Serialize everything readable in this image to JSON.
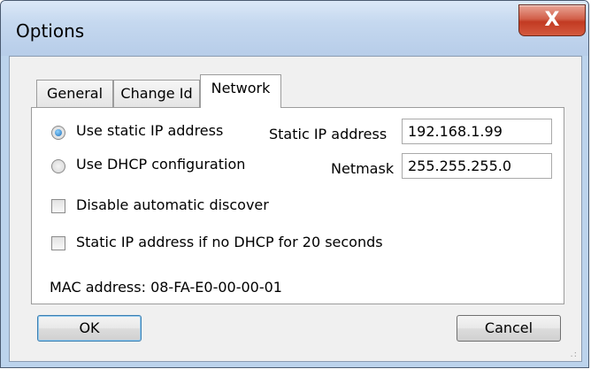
{
  "window": {
    "title": "Options",
    "close_glyph": "X"
  },
  "tabs": [
    {
      "label": "General"
    },
    {
      "label": "Change Id"
    },
    {
      "label": "Network"
    }
  ],
  "network": {
    "static_radio_label": "Use static IP address",
    "dhcp_radio_label": "Use DHCP configuration",
    "selected_mode": "static",
    "static_ip_label": "Static IP address",
    "static_ip_value": "192.168.1.99",
    "netmask_label": "Netmask",
    "netmask_value": "255.255.255.0",
    "disable_discover_label": "Disable automatic discover",
    "disable_discover_checked": false,
    "static_fallback_label": "Static IP address if no DHCP for 20 seconds",
    "static_fallback_checked": false,
    "mac_text": "MAC address: 08-FA-E0-00-00-01"
  },
  "buttons": {
    "ok_label": "OK",
    "cancel_label": "Cancel"
  },
  "colors": {
    "accent": "#1f6fb9",
    "close_red": "#c23a22"
  }
}
